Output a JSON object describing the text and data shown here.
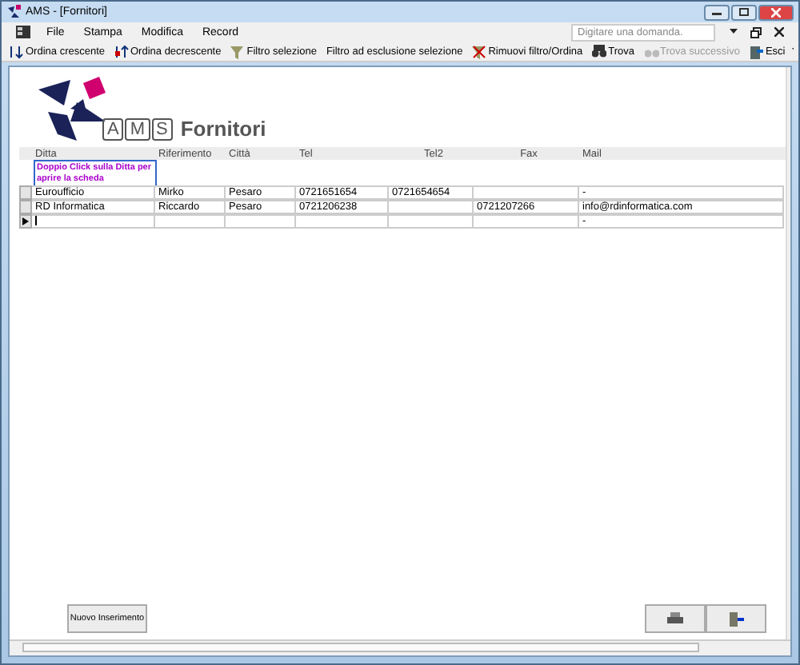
{
  "window": {
    "title": "AMS - [Fornitori]"
  },
  "menu": [
    "File",
    "Stampa",
    "Modifica",
    "Record"
  ],
  "help_search": {
    "placeholder": "Digitare una domanda."
  },
  "toolbar": [
    {
      "label": "Ordina crescente",
      "kind": "sort-asc",
      "disabled": false
    },
    {
      "label": "Ordina decrescente",
      "kind": "sort-desc",
      "disabled": false
    },
    {
      "label": "Filtro selezione",
      "kind": "filter",
      "disabled": false
    },
    {
      "label": "Filtro ad esclusione selezione",
      "kind": "text",
      "disabled": false
    },
    {
      "label": "Rimuovi filtro/Ordina",
      "kind": "remove-filter",
      "disabled": false
    },
    {
      "label": "Trova",
      "kind": "find",
      "disabled": false
    },
    {
      "label": "Trova successivo",
      "kind": "find-next",
      "disabled": true
    },
    {
      "label": "Esci",
      "kind": "exit",
      "disabled": false
    }
  ],
  "form": {
    "logo": [
      "A",
      "M",
      "S"
    ],
    "title": "Fornitori",
    "hint": "Doppio Click sulla Ditta per aprire la scheda",
    "columns": [
      "Ditta",
      "Riferimento",
      "Città",
      "Tel",
      "Tel2",
      "Fax",
      "Mail"
    ],
    "rows": [
      {
        "current": false,
        "cells": [
          "Euroufficio",
          "Mirko",
          "Pesaro",
          "0721651654",
          "0721654654",
          "",
          "-"
        ]
      },
      {
        "current": false,
        "cells": [
          "RD Informatica",
          "Riccardo",
          "Pesaro",
          "0721206238",
          "",
          "0721207266",
          "info@rdinformatica.com"
        ]
      },
      {
        "current": true,
        "cells": [
          "",
          "",
          "",
          "",
          "",
          "",
          "-"
        ]
      }
    ],
    "new_button": "Nuovo Inserimento"
  }
}
